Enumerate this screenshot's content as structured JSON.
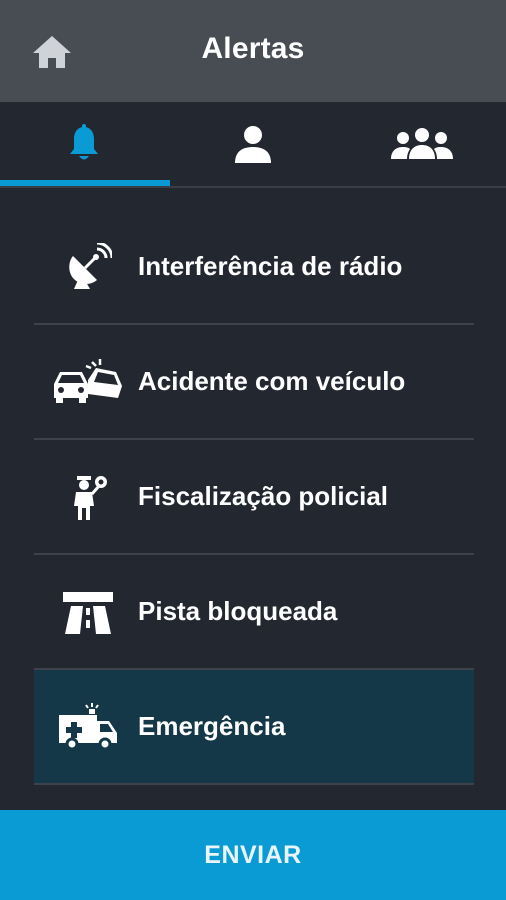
{
  "header": {
    "title": "Alertas",
    "home_icon": "home-icon"
  },
  "tabs": [
    {
      "icon": "bell-icon",
      "active": true,
      "color": "#0b9bd4"
    },
    {
      "icon": "person-icon",
      "active": false,
      "color": "#ffffff"
    },
    {
      "icon": "group-icon",
      "active": false,
      "color": "#ffffff"
    }
  ],
  "alerts": [
    {
      "label": "Interferência de rádio",
      "icon": "satellite-dish-icon",
      "selected": false
    },
    {
      "label": "Acidente com veículo",
      "icon": "car-crash-icon",
      "selected": false
    },
    {
      "label": "Fiscalização policial",
      "icon": "police-officer-icon",
      "selected": false
    },
    {
      "label": "Pista bloqueada",
      "icon": "road-blocked-icon",
      "selected": false
    },
    {
      "label": "Emergência",
      "icon": "ambulance-icon",
      "selected": true
    }
  ],
  "footer": {
    "send_label": "ENVIAR"
  },
  "colors": {
    "accent": "#0b9bd4",
    "selected_row": "#143847",
    "background": "#232830",
    "header": "#484c53"
  }
}
